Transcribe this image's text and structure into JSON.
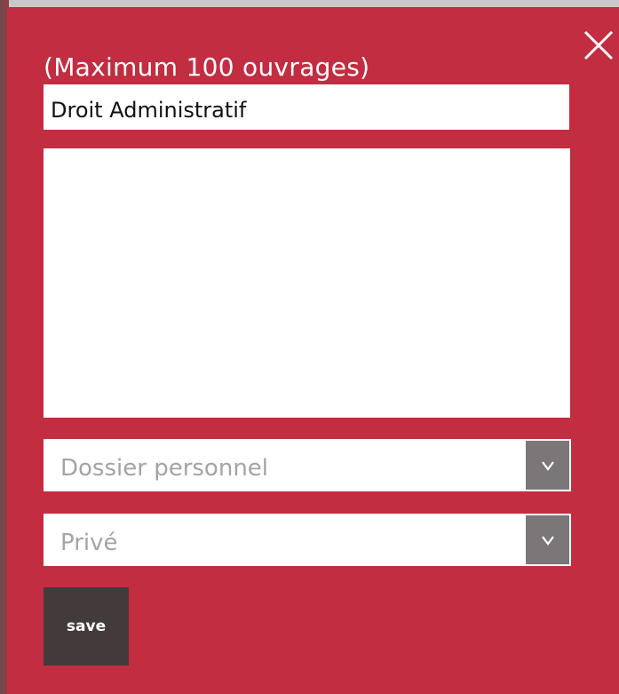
{
  "dialog": {
    "hint": "(Maximum 100 ouvrages)",
    "close_icon": "close-icon",
    "colors": {
      "background": "#c22d41",
      "save_button": "#433a3b",
      "dropdown_arrow": "#7b7677",
      "placeholder": "#a4a4a4"
    }
  },
  "form": {
    "title_value": "Droit Administratif",
    "description_value": "",
    "folder_select": {
      "selected": "Dossier personnel",
      "arrow_icon": "chevron-down-icon"
    },
    "privacy_select": {
      "selected": "Privé",
      "arrow_icon": "chevron-down-icon"
    },
    "save_label": "save"
  }
}
